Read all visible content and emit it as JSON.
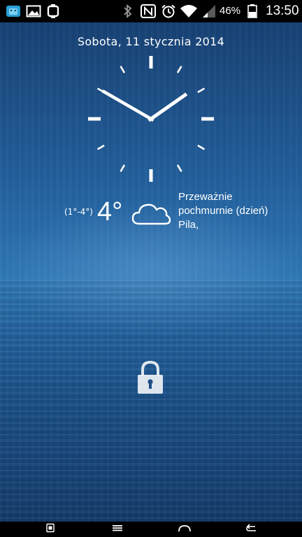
{
  "status_bar": {
    "left_icons": [
      "android-notification-icon",
      "gallery-icon",
      "watch-icon"
    ],
    "right_icons": [
      "bluetooth-icon",
      "nfc-icon",
      "alarm-icon",
      "wifi-icon",
      "cell-signal-icon",
      "battery-icon"
    ],
    "battery_percent": "46%",
    "time": "13:50"
  },
  "lockscreen": {
    "date": "Sobota, 11 stycznia 2014",
    "clock": {
      "hours": 1,
      "minutes": 50
    },
    "weather": {
      "range": "(1°-4°)",
      "current_temp": "4°",
      "icon": "cloud-icon",
      "description_line1": "Przeważnie",
      "description_line2": "pochmurnie (dzień)",
      "location": "Pila,"
    },
    "lock_icon": "padlock-icon"
  },
  "nav_bar": {
    "buttons": [
      "app-drawer-icon",
      "menu-icon",
      "home-icon",
      "back-icon"
    ]
  }
}
